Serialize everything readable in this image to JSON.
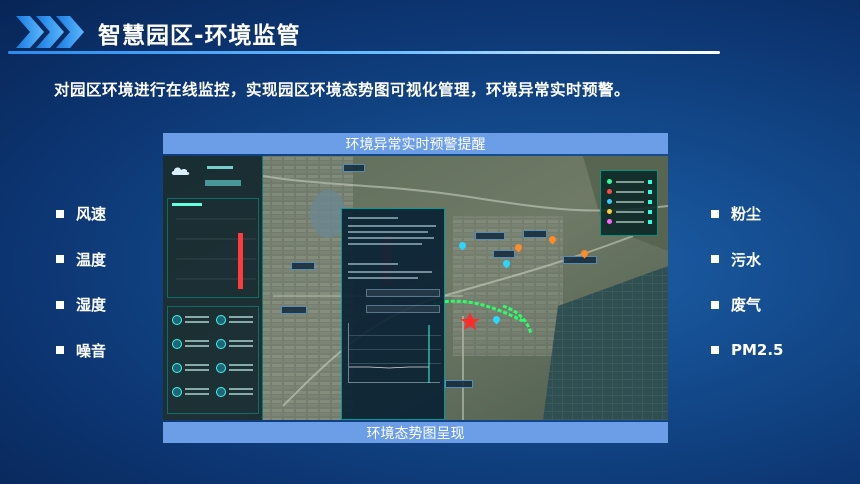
{
  "header": {
    "title": "智慧园区-环境监管",
    "subtitle": "对园区环境进行在线监控，实现园区环境态势图可视化管理，环境异常实时预警。"
  },
  "left_list": {
    "items": [
      {
        "label": "风速"
      },
      {
        "label": "温度"
      },
      {
        "label": "湿度"
      },
      {
        "label": "噪音"
      }
    ]
  },
  "right_list": {
    "items": [
      {
        "label": "粉尘"
      },
      {
        "label": "污水"
      },
      {
        "label": "废气"
      },
      {
        "label": "PM2.5"
      }
    ]
  },
  "screenshot": {
    "top_caption": "环境异常实时预警提醒",
    "bottom_caption": "环境态势图呈现"
  },
  "colors": {
    "accent_line": "#2a8cf0",
    "caption_band": "#6c9ee8",
    "panel_border": "#00e6d2",
    "alert_star": "#ff2a2a"
  },
  "icons": {
    "header": "triple-chevron-right-icon",
    "bullet": "square-bullet-icon"
  }
}
